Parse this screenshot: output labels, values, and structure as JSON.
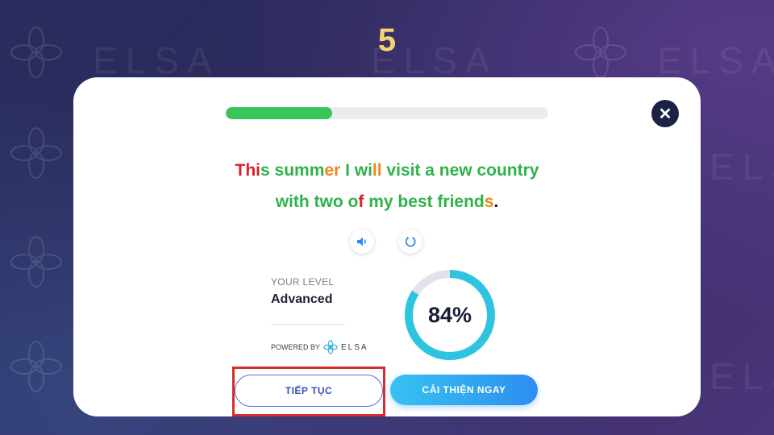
{
  "step_number": "5",
  "watermark_text": "ELSA",
  "progress": {
    "fraction": 0.33,
    "fill_color": "#3ac55a"
  },
  "close_icon": "close-icon",
  "sentence": {
    "line1": [
      {
        "text": "Thi",
        "color": "red"
      },
      {
        "text": "s summ",
        "color": "green"
      },
      {
        "text": "er",
        "color": "orange"
      },
      {
        "text": " I wi",
        "color": "green"
      },
      {
        "text": "ll",
        "color": "orange"
      },
      {
        "text": " visit a new country",
        "color": "green"
      }
    ],
    "line2": [
      {
        "text": "with two o",
        "color": "green"
      },
      {
        "text": "f",
        "color": "red"
      },
      {
        "text": " my best friend",
        "color": "green"
      },
      {
        "text": "s",
        "color": "orange"
      },
      {
        "text": ".",
        "color": "black"
      }
    ]
  },
  "controls": {
    "speaker_icon": "speaker-icon",
    "replay_icon": "replay-icon"
  },
  "level": {
    "label": "YOUR LEVEL",
    "value": "Advanced"
  },
  "powered_by": {
    "label": "POWERED BY",
    "brand": "ELSA"
  },
  "score": {
    "value": 84,
    "text": "84%"
  },
  "buttons": {
    "continue_label": "TIẾP TỤC",
    "improve_label": "CẢI THIỆN NGAY"
  },
  "colors": {
    "accent_blue": "#2d8ef0",
    "title_yellow": "#f7d46b",
    "highlight_red": "#d92b2b"
  }
}
